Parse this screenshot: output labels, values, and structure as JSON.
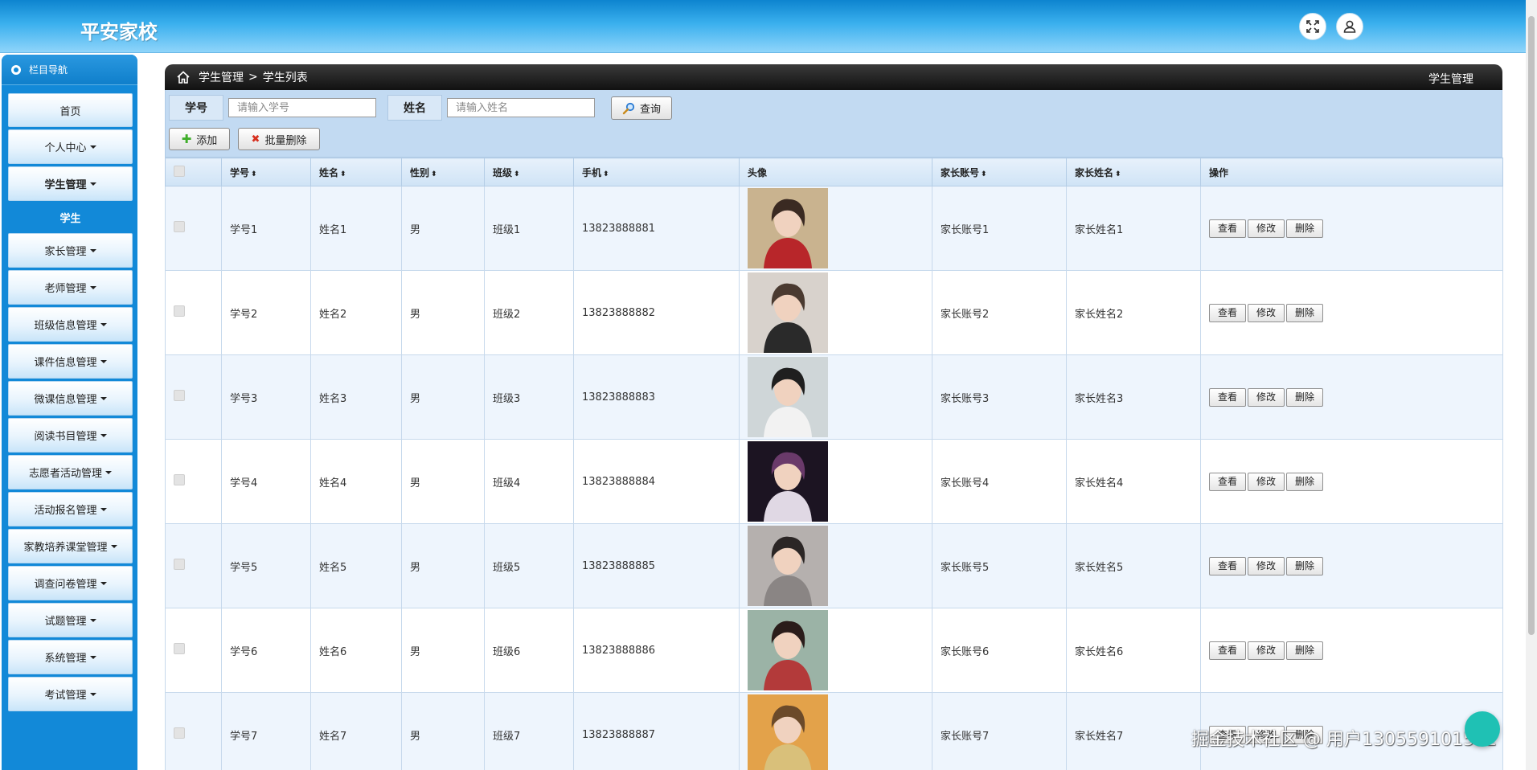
{
  "header": {
    "site_title": "平安家校",
    "fullscreen_icon": "fullscreen-icon",
    "user_icon": "user-icon"
  },
  "sidebar": {
    "title": "栏目导航",
    "items": [
      {
        "label": "首页",
        "caret": false
      },
      {
        "label": "个人中心",
        "caret": true
      },
      {
        "label": "学生管理",
        "caret": true,
        "active": true
      },
      {
        "label": "学生",
        "sub": true
      },
      {
        "label": "家长管理",
        "caret": true
      },
      {
        "label": "老师管理",
        "caret": true
      },
      {
        "label": "班级信息管理",
        "caret": true
      },
      {
        "label": "课件信息管理",
        "caret": true
      },
      {
        "label": "微课信息管理",
        "caret": true
      },
      {
        "label": "阅读书目管理",
        "caret": true
      },
      {
        "label": "志愿者活动管理",
        "caret": true
      },
      {
        "label": "活动报名管理",
        "caret": true
      },
      {
        "label": "家教培养课堂管理",
        "caret": true
      },
      {
        "label": "调查问卷管理",
        "caret": true
      },
      {
        "label": "试题管理",
        "caret": true
      },
      {
        "label": "系统管理",
        "caret": true
      },
      {
        "label": "考试管理",
        "caret": true
      }
    ]
  },
  "breadcrumb": {
    "level1": "学生管理",
    "separator": ">",
    "level2": "学生列表",
    "right_title": "学生管理"
  },
  "search": {
    "student_no_label": "学号",
    "student_no_placeholder": "请输入学号",
    "name_label": "姓名",
    "name_placeholder": "请输入姓名",
    "query_button": "查询"
  },
  "actions": {
    "add_button": "添加",
    "batch_delete_button": "批量删除"
  },
  "table": {
    "columns": [
      "学号",
      "姓名",
      "性别",
      "班级",
      "手机",
      "头像",
      "家长账号",
      "家长姓名",
      "操作"
    ],
    "sortable": [
      true,
      true,
      true,
      true,
      true,
      false,
      true,
      true,
      false
    ],
    "row_buttons": {
      "view": "查看",
      "edit": "修改",
      "delete": "删除"
    },
    "rows": [
      {
        "no": "学号1",
        "name": "姓名1",
        "gender": "男",
        "class": "班级1",
        "phone": "13823888881",
        "parent_account": "家长账号1",
        "parent_name": "家长姓名1",
        "avatar": "avatar-1"
      },
      {
        "no": "学号2",
        "name": "姓名2",
        "gender": "男",
        "class": "班级2",
        "phone": "13823888882",
        "parent_account": "家长账号2",
        "parent_name": "家长姓名2",
        "avatar": "avatar-2"
      },
      {
        "no": "学号3",
        "name": "姓名3",
        "gender": "男",
        "class": "班级3",
        "phone": "13823888883",
        "parent_account": "家长账号3",
        "parent_name": "家长姓名3",
        "avatar": "avatar-3"
      },
      {
        "no": "学号4",
        "name": "姓名4",
        "gender": "男",
        "class": "班级4",
        "phone": "13823888884",
        "parent_account": "家长账号4",
        "parent_name": "家长姓名4",
        "avatar": "avatar-4"
      },
      {
        "no": "学号5",
        "name": "姓名5",
        "gender": "男",
        "class": "班级5",
        "phone": "13823888885",
        "parent_account": "家长账号5",
        "parent_name": "家长姓名5",
        "avatar": "avatar-5"
      },
      {
        "no": "学号6",
        "name": "姓名6",
        "gender": "男",
        "class": "班级6",
        "phone": "13823888886",
        "parent_account": "家长账号6",
        "parent_name": "家长姓名6",
        "avatar": "avatar-6"
      },
      {
        "no": "学号7",
        "name": "姓名7",
        "gender": "男",
        "class": "班级7",
        "phone": "13823888887",
        "parent_account": "家长账号7",
        "parent_name": "家长姓名7",
        "avatar": "avatar-7"
      }
    ]
  },
  "watermark": "掘金技术社区 @ 用户130559101592",
  "colors": {
    "header_gradient_top": "#0d84cf",
    "sidebar_bg": "#1289d8",
    "toolbar_bg": "#c2daf2",
    "breadcrumb_bg": "#1a1a1a",
    "row_alt_bg": "#eef5fd"
  }
}
